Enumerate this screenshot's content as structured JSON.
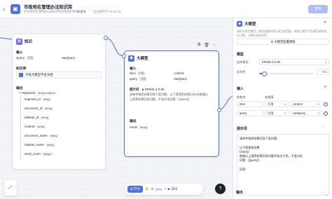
{
  "header": {
    "back_icon": "chevron-left",
    "app_title": "市政地名管理办法知识库",
    "app_desc": "仅市政地名管理办法知识库提供回答参考...",
    "status": "未发布",
    "autosave": "自动保存于 15:14:33",
    "publish_label": "发布",
    "accent_color": "#4e6ef2"
  },
  "knowledge_node": {
    "title": "知识",
    "input_label": "输入",
    "input_row": {
      "name": "Query",
      "type": "引用",
      "value": "rawQuery"
    },
    "kb_label": "知识库",
    "kb_name": "千帆大模型平台文档",
    "output_label": "输出",
    "output_root": {
      "name": "OutputList",
      "type": "Array<object>"
    },
    "outputs": [
      {
        "name": "segment_id",
        "type": "string"
      },
      {
        "name": "document_id",
        "type": "string"
      },
      {
        "name": "dataset_id",
        "type": "string"
      },
      {
        "name": "content",
        "type": "string"
      },
      {
        "name": "document_name",
        "type": "string"
      },
      {
        "name": "dataset_name",
        "type": "string"
      },
      {
        "name": "word_count",
        "type": "integer"
      }
    ]
  },
  "llm_node": {
    "title": "大模型",
    "input_label": "输入",
    "inputs": [
      {
        "name": "slice",
        "type": "引用",
        "value": "content"
      },
      {
        "name": "query",
        "type": "引用",
        "value": "rawQuery"
      }
    ],
    "prompt_label": "提示词",
    "model_name": "ERNIE-4.0-8K",
    "prompt_lines": [
      "请参考搜索结果回答下面问题。以下是搜索结果{{slice}}根据以",
      "上搜索结果回答问题。不变对话问题：{{query}}"
    ],
    "output_label": "输出",
    "output": {
      "name": "result",
      "type": "String"
    }
  },
  "canvas_toolbar": {
    "add_node_label": "节点",
    "zoom": "87%",
    "debug_label": "调试",
    "help_label": "?"
  },
  "panel": {
    "title": "大模型",
    "desc": "调用大语言模型，使用变量和提示词生成回复，按照大模型平台模型调用进行计费，计费及调用说明",
    "config_button": "大模型配置模板",
    "model_section": "模型",
    "model_label": "选择模型",
    "model_value": "ERNIE-4.0-8K",
    "temp_label": "多样性",
    "temp_value": "0.1",
    "temp_fraction": 0.1,
    "input_section": "输入",
    "col_param": "参数名",
    "col_type": "变量值",
    "inputs": [
      {
        "name": "slice",
        "type": "引用",
        "value": "content"
      },
      {
        "name": "query",
        "type": "引用",
        "value": "rawQuery"
      }
    ],
    "prompt_section": "提示词",
    "prompt_text": "请参考搜索结果回答下面问题。\n\n以下是搜索结果\n{{slice}}\n根据以上搜索结果回答问题并标注引用，不变对话\n问题：{{query}}\n\n回答：",
    "output_section": "输出"
  }
}
